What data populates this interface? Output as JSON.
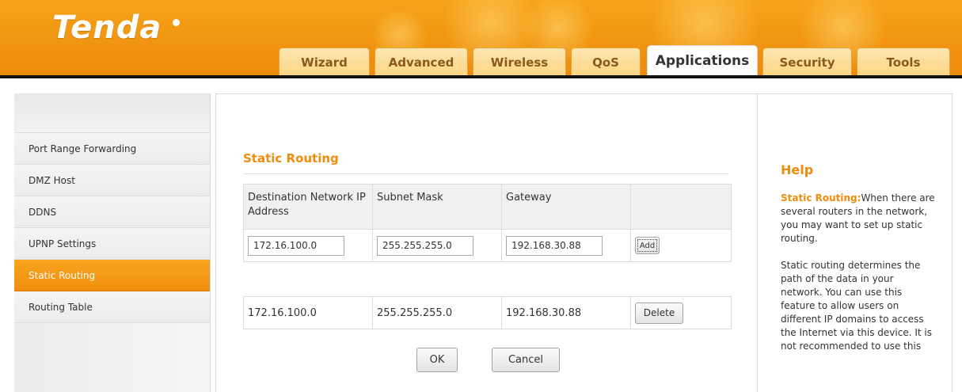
{
  "header": {
    "logo": "Tenda",
    "tabs": [
      {
        "label": "Wizard"
      },
      {
        "label": "Advanced"
      },
      {
        "label": "Wireless"
      },
      {
        "label": "QoS"
      },
      {
        "label": "Applications"
      },
      {
        "label": "Security"
      },
      {
        "label": "Tools"
      }
    ],
    "active_tab": "Applications"
  },
  "sidebar": {
    "items": [
      {
        "label": "Port Range Forwarding"
      },
      {
        "label": "DMZ Host"
      },
      {
        "label": "DDNS"
      },
      {
        "label": "UPNP Settings"
      },
      {
        "label": "Static Routing"
      },
      {
        "label": "Routing Table"
      }
    ],
    "active_item": "Static Routing"
  },
  "main": {
    "title": "Static Routing",
    "columns": [
      "Destination Network IP Address",
      "Subnet Mask",
      "Gateway"
    ],
    "inputs": {
      "destination": "172.16.100.0",
      "subnet_mask": "255.255.255.0",
      "gateway": "192.168.30.88"
    },
    "add_label": "Add",
    "routes": [
      {
        "destination": "172.16.100.0",
        "subnet_mask": "255.255.255.0",
        "gateway": "192.168.30.88",
        "action": "Delete"
      }
    ],
    "ok_label": "OK",
    "cancel_label": "Cancel"
  },
  "help": {
    "title": "Help",
    "term": "Static Routing:",
    "p1_rest": "When there are several routers in the network, you may want to set up static routing.",
    "p2": "Static routing determines the path of the data in your network. You can use this feature to allow users on different IP domains to access the Internet via this device. It is not recommended to use this"
  },
  "colors": {
    "brand_orange": "#f39a14",
    "accent_text": "#f08c0c",
    "active_sidebar": "#f39a14"
  }
}
